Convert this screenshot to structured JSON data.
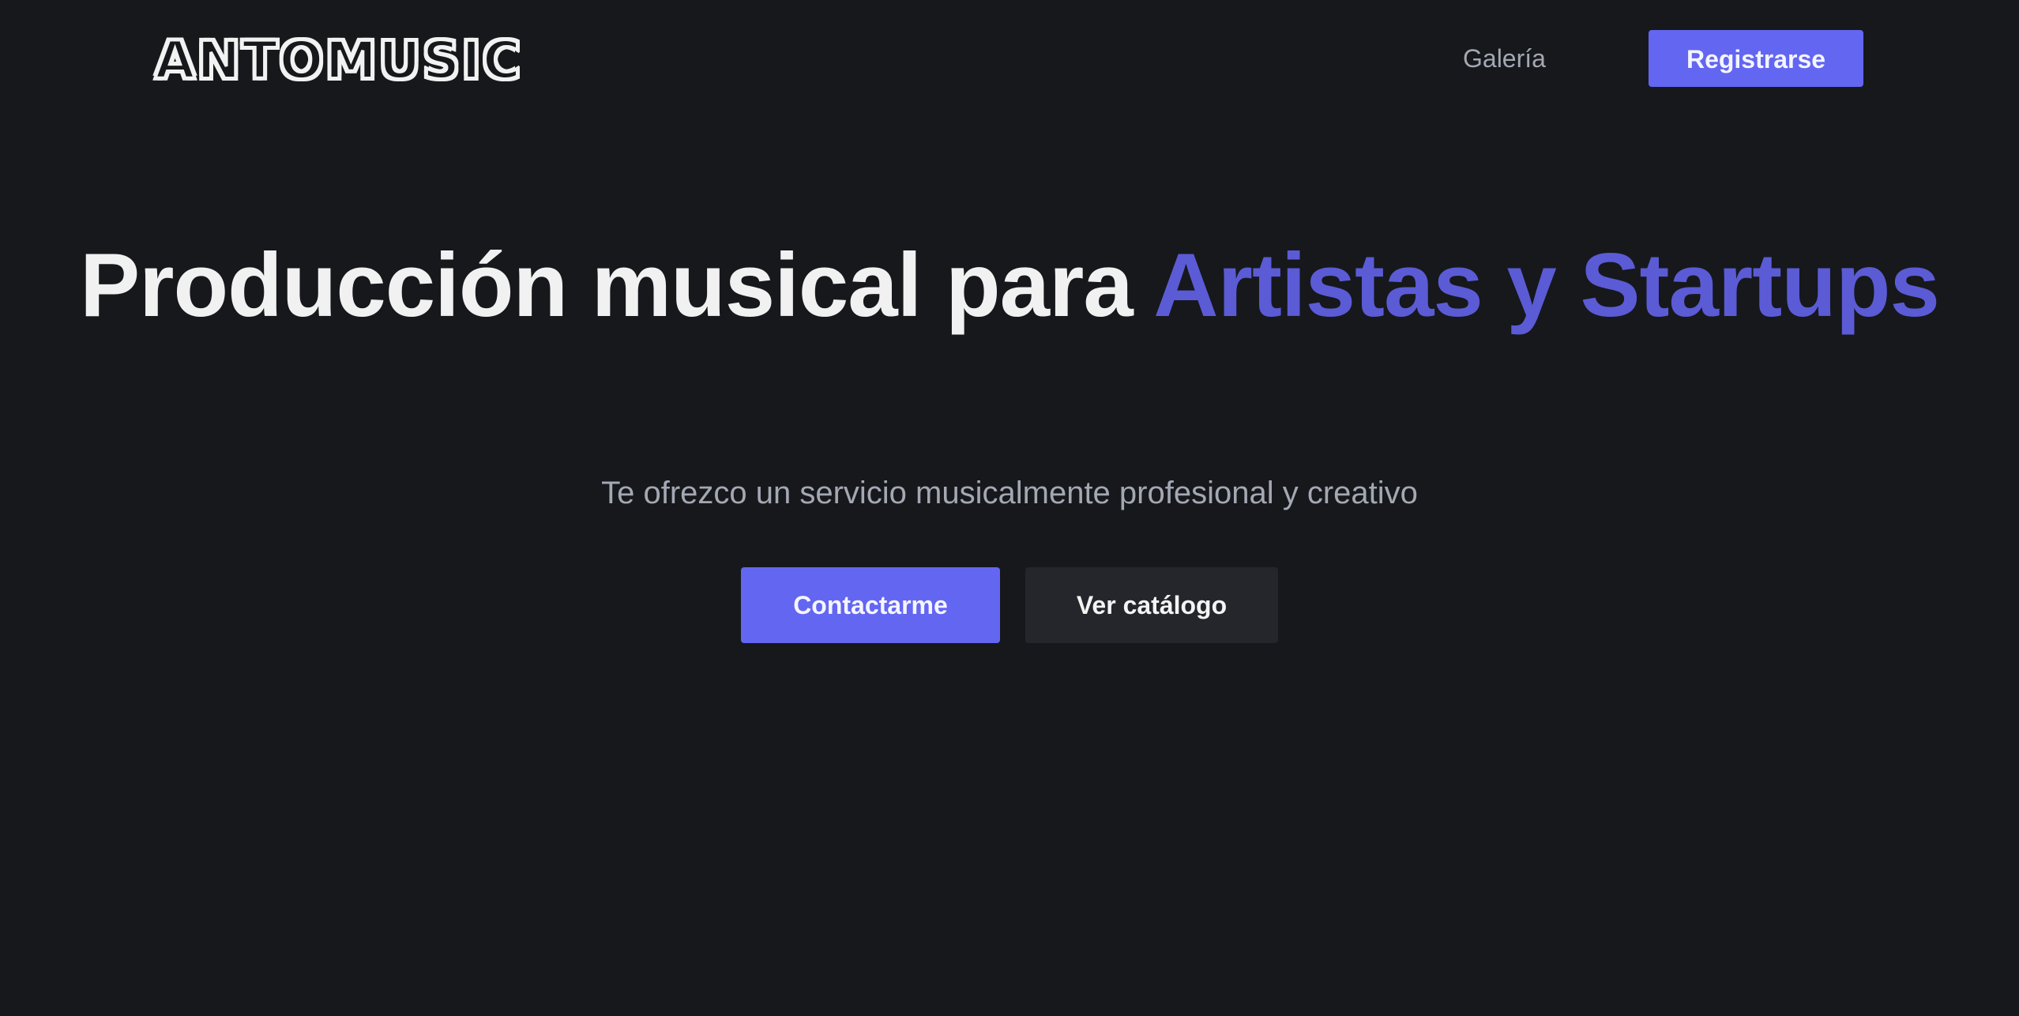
{
  "header": {
    "logo_text": "ANTOMUSIC",
    "nav": {
      "gallery_label": "Galería"
    },
    "register_label": "Registrarse"
  },
  "hero": {
    "title_part1": "Producción musical para ",
    "title_accent": "Artistas y Startups",
    "subtitle": "Te ofrezco un servicio musicalmente profesional y creativo",
    "primary_cta": "Contactarme",
    "secondary_cta": "Ver catálogo"
  },
  "colors": {
    "background": "#16181c",
    "accent": "#6366f1",
    "accent_text": "#5b5bd6",
    "muted_text": "#a3a8b3",
    "secondary_button": "#24262b"
  }
}
